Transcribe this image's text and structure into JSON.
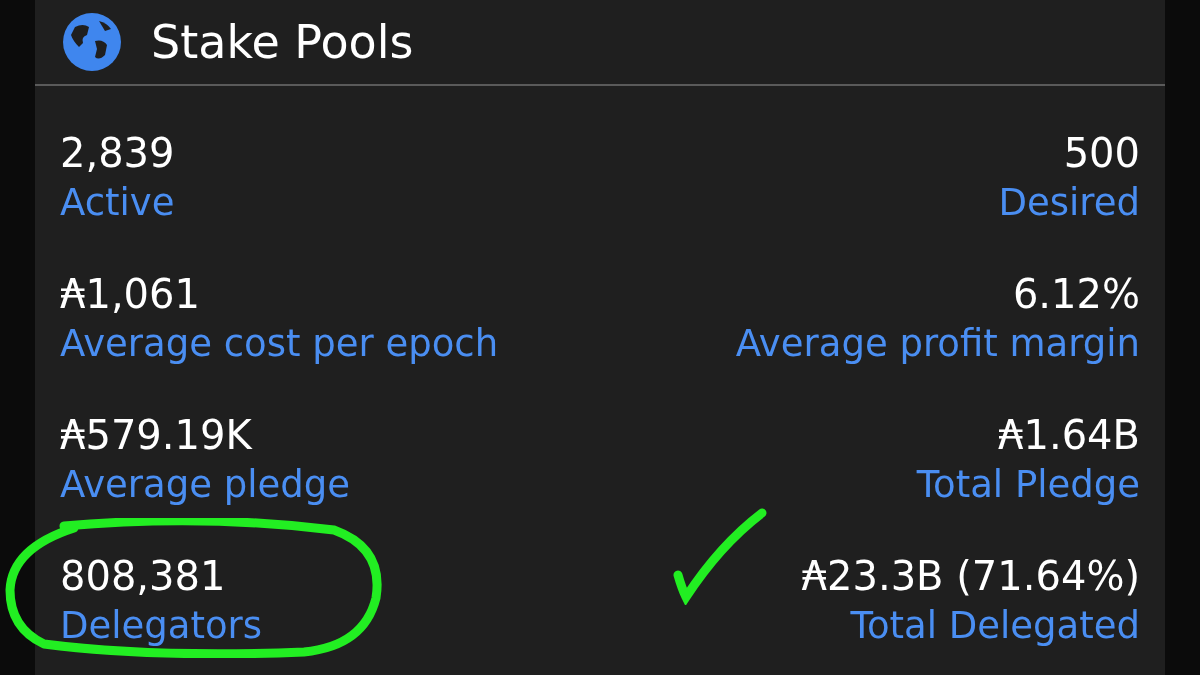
{
  "header": {
    "title": "Stake Pools"
  },
  "stats": [
    {
      "value": "2,839",
      "label": "Active"
    },
    {
      "value": "500",
      "label": "Desired"
    },
    {
      "value": "₳1,061",
      "label": "Average cost per epoch"
    },
    {
      "value": "6.12%",
      "label": "Average profit margin"
    },
    {
      "value": "₳579.19K",
      "label": "Average pledge"
    },
    {
      "value": "₳1.64B",
      "label": "Total Pledge"
    },
    {
      "value": "808,381",
      "label": "Delegators"
    },
    {
      "value": "₳23.3B (71.64%)",
      "label": "Total Delegated"
    }
  ]
}
